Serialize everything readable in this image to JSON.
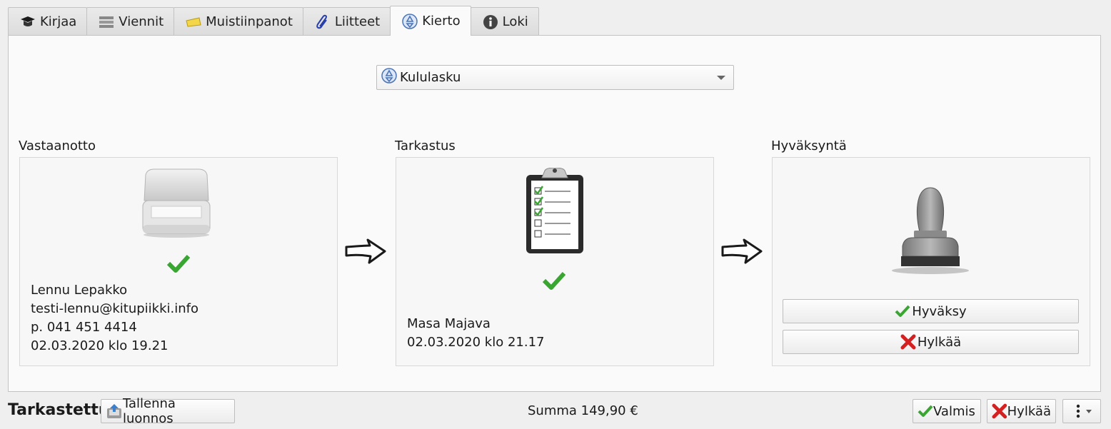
{
  "tabs": [
    {
      "label": "Kirjaa",
      "icon": "hat-icon"
    },
    {
      "label": "Viennit",
      "icon": "list-icon"
    },
    {
      "label": "Muistiinpanot",
      "icon": "note-icon"
    },
    {
      "label": "Liitteet",
      "icon": "paperclip-icon"
    },
    {
      "label": "Kierto",
      "icon": "cycle-icon"
    },
    {
      "label": "Loki",
      "icon": "info-icon"
    }
  ],
  "circulation": {
    "selected": "Kululasku"
  },
  "stages": [
    {
      "title": "Vastaanotto",
      "lines": [
        "Lennu Lepakko",
        "testi-lennu@kitupiikki.info",
        "p. 041 451 4414",
        "02.03.2020 klo 19.21"
      ]
    },
    {
      "title": "Tarkastus",
      "lines": [
        "Masa Majava",
        "02.03.2020 klo 21.17"
      ]
    },
    {
      "title": "Hyväksyntä",
      "approve_label": "Hyväksy",
      "reject_label": "Hylkää"
    }
  ],
  "footer": {
    "status": "Tarkastettu",
    "save_draft": "Tallenna luonnos",
    "sum": "Summa 149,90 €",
    "done": "Valmis",
    "reject": "Hylkää"
  },
  "colors": {
    "check": "#3aa632",
    "cross": "#d42020",
    "accent_blue": "#4a74b8"
  }
}
